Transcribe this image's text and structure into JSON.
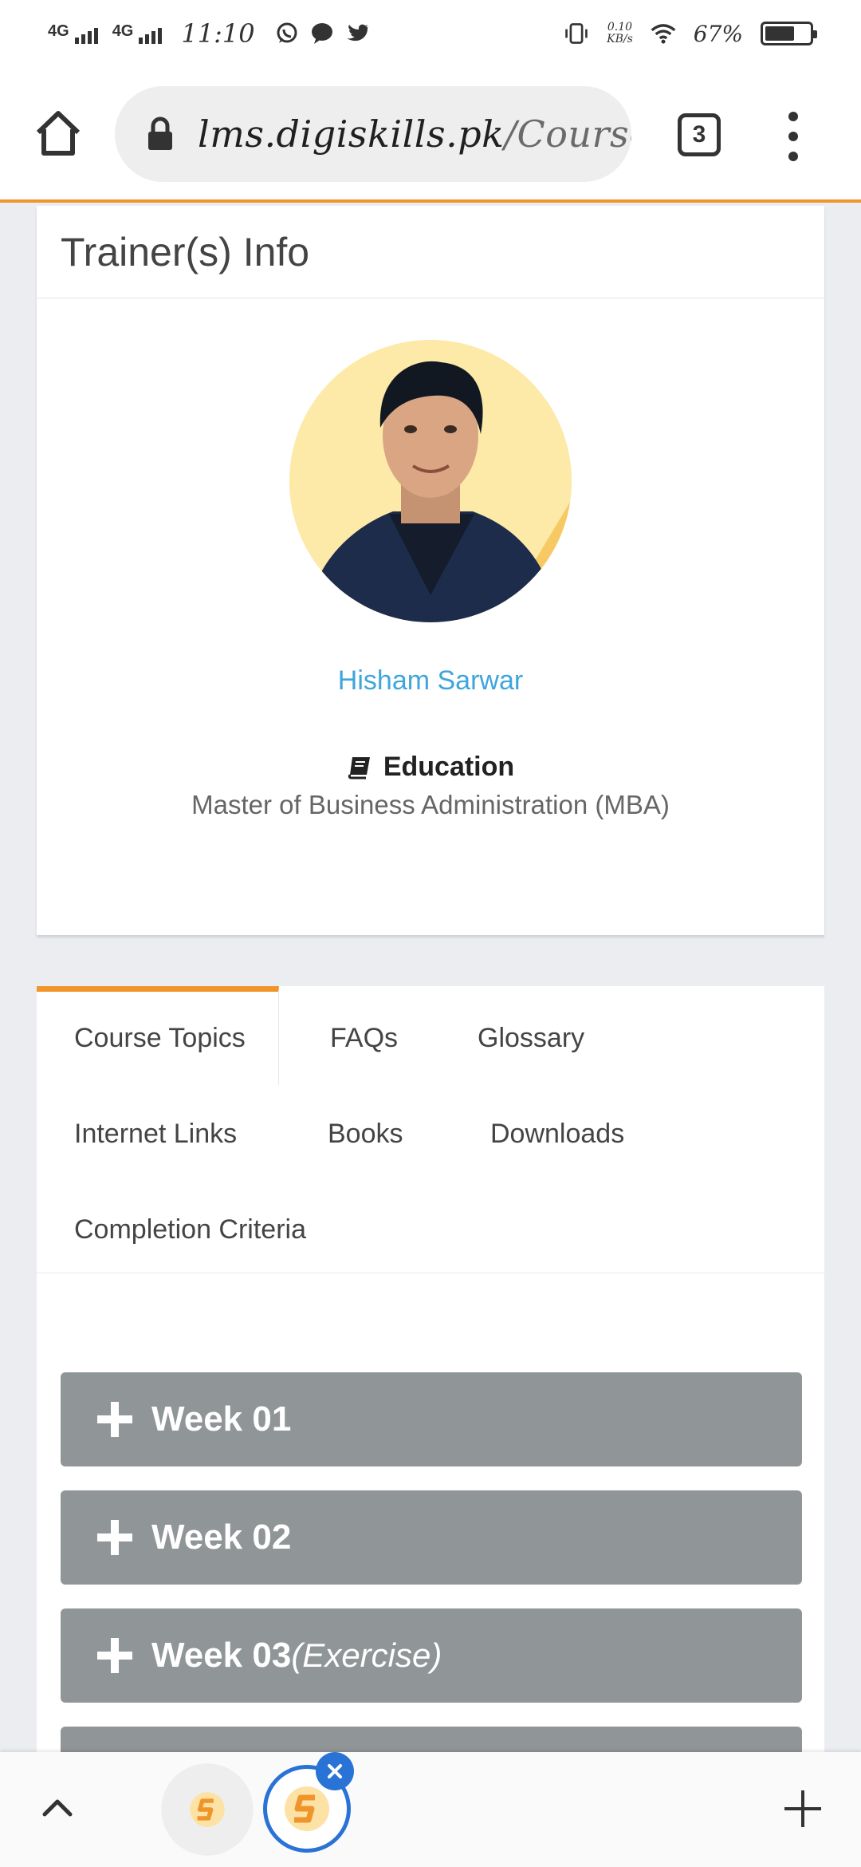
{
  "status_bar": {
    "network1": "4G",
    "network2": "4G",
    "time": "11:10",
    "speed_value": "0.10",
    "speed_unit": "KB/s",
    "battery_percent": "67%",
    "battery_level": 0.67,
    "icons": [
      "whatsapp-icon",
      "chat-bubble-icon",
      "twitter-icon",
      "vibrate-icon",
      "wifi-icon",
      "battery-icon"
    ]
  },
  "browser": {
    "url_host": "lms.digiskills.pk",
    "url_path": "/Course",
    "tab_count": "3"
  },
  "trainer": {
    "section_title": "Trainer(s) Info",
    "name": "Hisham Sarwar",
    "education_label": "Education",
    "education_value": "Master of Business Administration (MBA)"
  },
  "course_tabs": {
    "items": [
      {
        "label": "Course Topics",
        "active": true
      },
      {
        "label": "FAQs"
      },
      {
        "label": "Glossary"
      },
      {
        "label": "Internet Links"
      },
      {
        "label": "Books"
      },
      {
        "label": "Downloads"
      },
      {
        "label": "Completion Criteria"
      }
    ]
  },
  "weeks": [
    {
      "label": "Week 01",
      "note": ""
    },
    {
      "label": "Week 02",
      "note": ""
    },
    {
      "label": "Week 03",
      "note": "(Exercise)"
    }
  ],
  "colors": {
    "accent": "#f0952a",
    "link": "#3ea6dc",
    "week_bar": "#909597",
    "tab_switch_active": "#2a73d6"
  }
}
